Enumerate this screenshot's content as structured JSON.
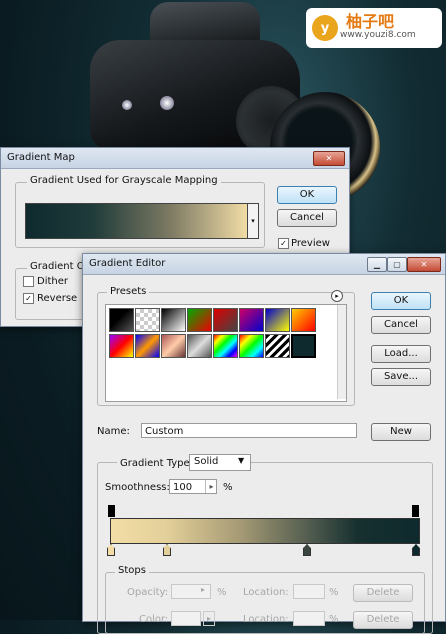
{
  "watermark": {
    "badge": "y",
    "name": "柚子吧",
    "url": "www.youzi8.com"
  },
  "gradient_map": {
    "title": "Gradient Map",
    "group_label": "Gradient Used for Grayscale Mapping",
    "ok": "OK",
    "cancel": "Cancel",
    "preview": "Preview",
    "options_label": "Gradient Op",
    "dither": "Dither",
    "reverse": "Reverse"
  },
  "gradient_editor": {
    "title": "Gradient Editor",
    "presets_label": "Presets",
    "ok": "OK",
    "cancel": "Cancel",
    "load": "Load...",
    "save": "Save...",
    "name_label": "Name:",
    "name_value": "Custom",
    "new": "New",
    "type_label": "Gradient Type:",
    "type_value": "Solid",
    "smoothness_label": "Smoothness:",
    "smoothness_value": "100",
    "smoothness_unit": "%",
    "stops_label": "Stops",
    "opacity_label": "Opacity:",
    "percent": "%",
    "location_label": "Location:",
    "delete": "Delete",
    "color_label": "Color:",
    "colors": {
      "dark": "#0f2a2e",
      "cream": "#f2dda6"
    }
  },
  "icons": {
    "minimize": "minimize-icon",
    "maximize": "maximize-icon",
    "close": "close-icon",
    "menu": "arrow-menu-icon",
    "dropdown": "chevron-down-icon"
  }
}
